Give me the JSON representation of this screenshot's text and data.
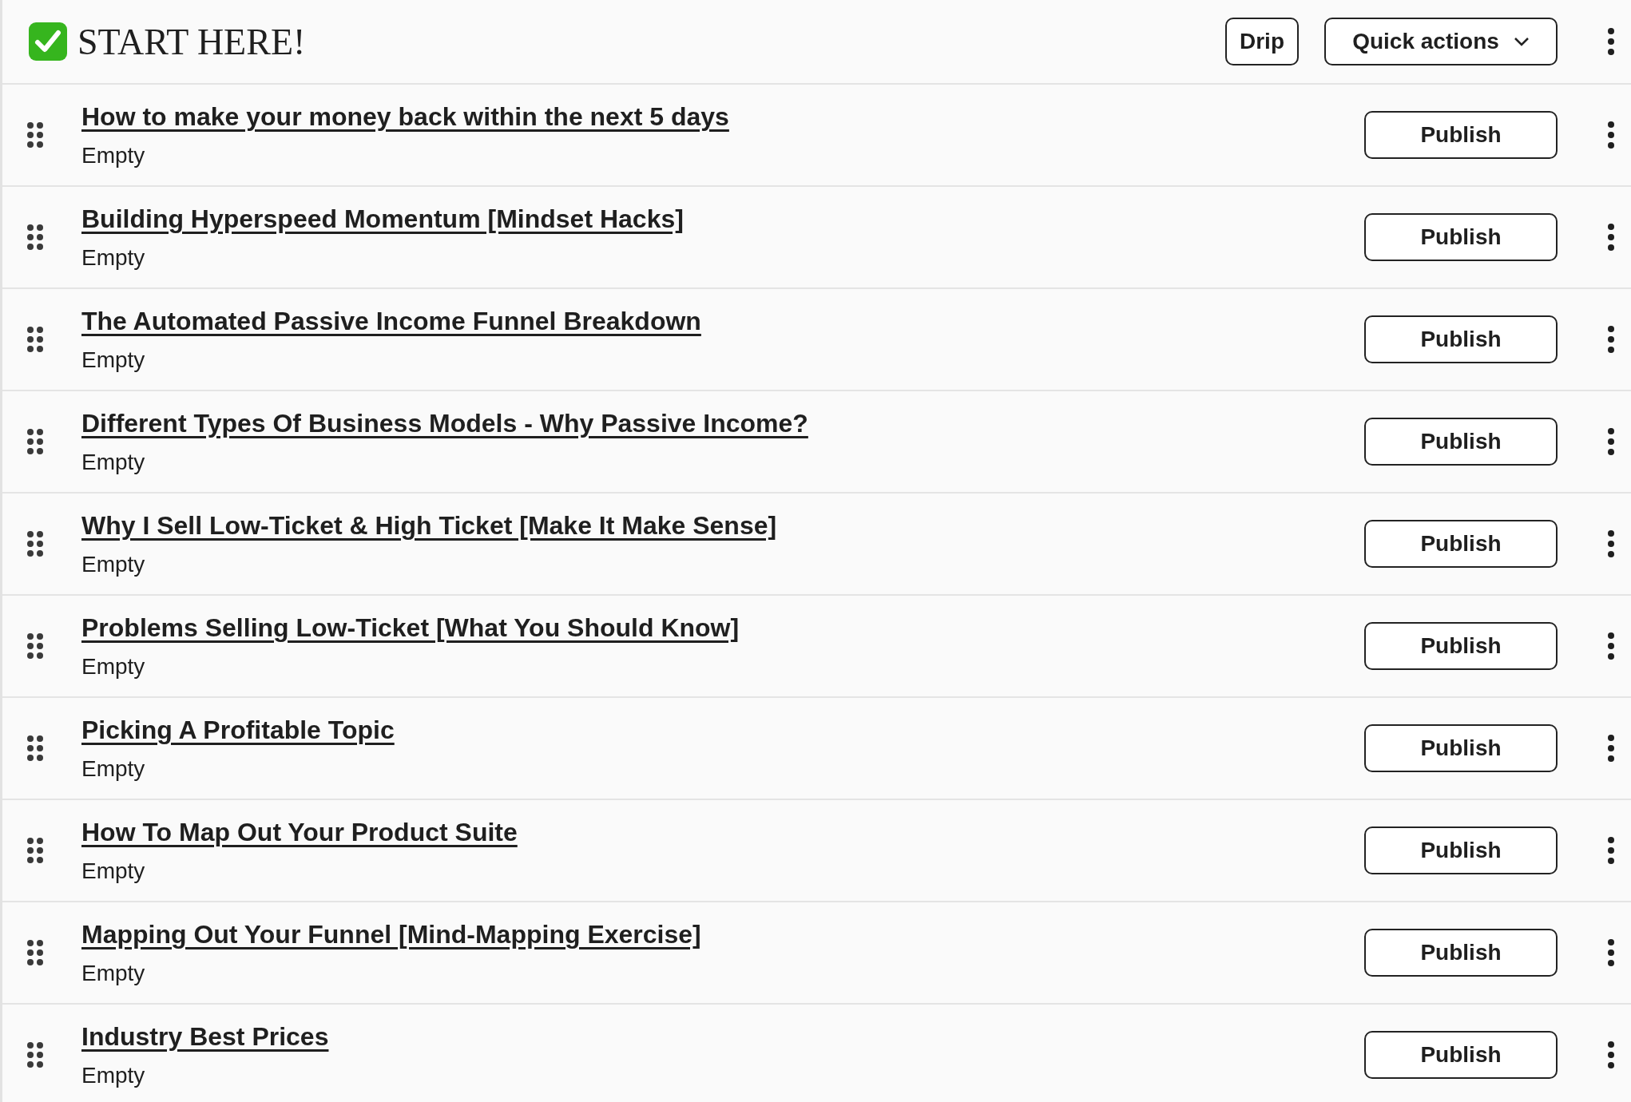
{
  "header": {
    "title": "START HERE!",
    "drip_button": "Drip",
    "quick_actions_button": "Quick actions"
  },
  "lessons": [
    {
      "title": "How to make your money back within the next 5 days",
      "status": "Empty",
      "action": "Publish"
    },
    {
      "title": "Building Hyperspeed Momentum [Mindset Hacks]",
      "status": "Empty",
      "action": "Publish"
    },
    {
      "title": "The Automated Passive Income Funnel Breakdown",
      "status": "Empty",
      "action": "Publish"
    },
    {
      "title": "Different Types Of Business Models - Why Passive Income?",
      "status": "Empty",
      "action": "Publish"
    },
    {
      "title": "Why I Sell Low-Ticket & High Ticket [Make It Make Sense]",
      "status": "Empty",
      "action": "Publish"
    },
    {
      "title": "Problems Selling Low-Ticket [What You Should Know]",
      "status": "Empty",
      "action": "Publish"
    },
    {
      "title": "Picking A Profitable Topic",
      "status": "Empty",
      "action": "Publish"
    },
    {
      "title": "How To Map Out Your Product Suite",
      "status": "Empty",
      "action": "Publish"
    },
    {
      "title": "Mapping Out Your Funnel [Mind-Mapping Exercise]",
      "status": "Empty",
      "action": "Publish"
    },
    {
      "title": "Industry Best Prices",
      "status": "Empty",
      "action": "Publish"
    }
  ]
}
